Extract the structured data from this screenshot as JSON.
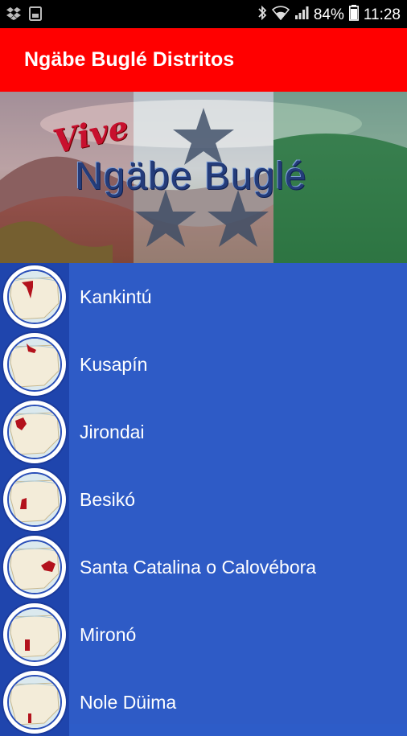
{
  "status": {
    "battery": "84%",
    "time": "11:28",
    "icons": [
      "dropbox-icon",
      "screenshot-icon",
      "bluetooth-icon",
      "wifi-icon",
      "signal-icon",
      "battery-icon"
    ]
  },
  "appbar": {
    "title": "Ngäbe Buglé Distritos",
    "color": "#ff0000"
  },
  "banner": {
    "script_text": "Vive",
    "main_text": "Ngäbe Buglé"
  },
  "districts": [
    {
      "label": "Kankintú"
    },
    {
      "label": "Kusapín"
    },
    {
      "label": "Jirondai"
    },
    {
      "label": "Besikó"
    },
    {
      "label": "Santa Catalina o Calovébora"
    },
    {
      "label": "Mironó"
    },
    {
      "label": "Nole Düima"
    }
  ],
  "colors": {
    "list_bg": "#2e5bc6",
    "thumb_column": "#1f45ad",
    "map_highlight": "#b3121c"
  }
}
